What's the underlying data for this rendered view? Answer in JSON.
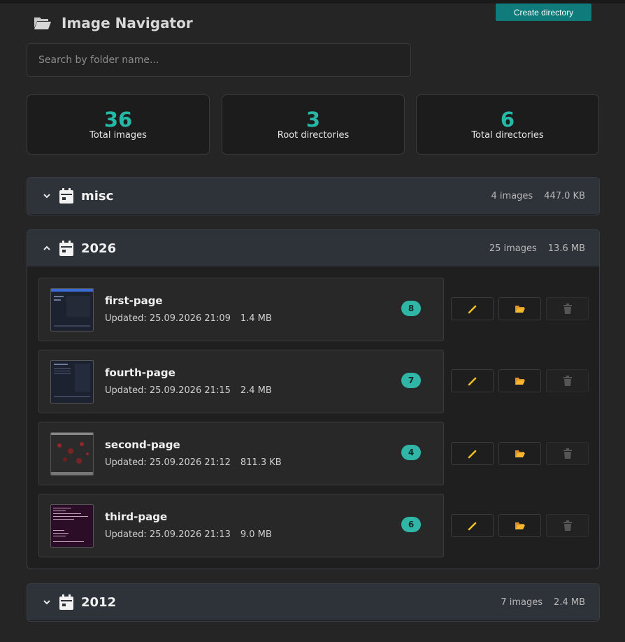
{
  "header": {
    "title": "Image Navigator",
    "title_icon": "folder-open-icon",
    "create_label": "Create directory"
  },
  "search": {
    "placeholder": "Search by folder name...",
    "value": ""
  },
  "stats": [
    {
      "value": "36",
      "label": "Total images"
    },
    {
      "value": "3",
      "label": "Root directories"
    },
    {
      "value": "6",
      "label": "Total directories"
    }
  ],
  "groups": [
    {
      "name": "misc",
      "count": "4 images",
      "size": "447.0 KB",
      "expanded": false,
      "icon": "calendar-icon"
    },
    {
      "name": "2026",
      "count": "25 images",
      "size": "13.6 MB",
      "expanded": true,
      "icon": "calendar-icon",
      "items": [
        {
          "name": "first-page",
          "updated": "Updated: 25.09.2026 21:09",
          "size": "1.4 MB",
          "count": "8"
        },
        {
          "name": "fourth-page",
          "updated": "Updated: 25.09.2026 21:15",
          "size": "2.4 MB",
          "count": "7"
        },
        {
          "name": "second-page",
          "updated": "Updated: 25.09.2026 21:12",
          "size": "811.3 KB",
          "count": "4"
        },
        {
          "name": "third-page",
          "updated": "Updated: 25.09.2026 21:13",
          "size": "9.0 MB",
          "count": "6"
        }
      ]
    },
    {
      "name": "2012",
      "count": "7 images",
      "size": "2.4 MB",
      "expanded": false,
      "icon": "calendar-icon"
    }
  ],
  "colors": {
    "accent": "#0f7b7b",
    "stat_number": "#26b8a6",
    "badge": "#2fb6a6",
    "pencil": "#f0c020",
    "folder": "#f5b82e"
  }
}
